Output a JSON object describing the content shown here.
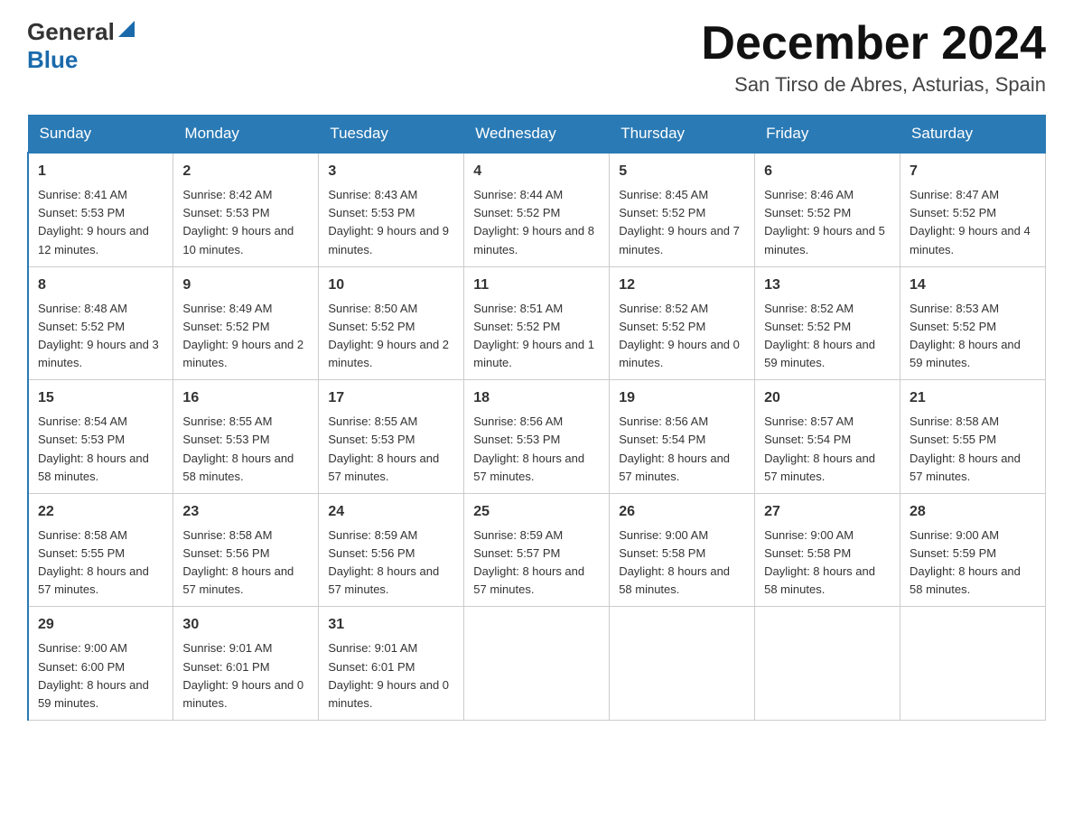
{
  "logo": {
    "general": "General",
    "blue": "Blue",
    "triangle": "▲"
  },
  "header": {
    "month_year": "December 2024",
    "location": "San Tirso de Abres, Asturias, Spain"
  },
  "weekdays": [
    "Sunday",
    "Monday",
    "Tuesday",
    "Wednesday",
    "Thursday",
    "Friday",
    "Saturday"
  ],
  "weeks": [
    [
      {
        "day": "1",
        "sunrise": "8:41 AM",
        "sunset": "5:53 PM",
        "daylight": "9 hours and 12 minutes."
      },
      {
        "day": "2",
        "sunrise": "8:42 AM",
        "sunset": "5:53 PM",
        "daylight": "9 hours and 10 minutes."
      },
      {
        "day": "3",
        "sunrise": "8:43 AM",
        "sunset": "5:53 PM",
        "daylight": "9 hours and 9 minutes."
      },
      {
        "day": "4",
        "sunrise": "8:44 AM",
        "sunset": "5:52 PM",
        "daylight": "9 hours and 8 minutes."
      },
      {
        "day": "5",
        "sunrise": "8:45 AM",
        "sunset": "5:52 PM",
        "daylight": "9 hours and 7 minutes."
      },
      {
        "day": "6",
        "sunrise": "8:46 AM",
        "sunset": "5:52 PM",
        "daylight": "9 hours and 5 minutes."
      },
      {
        "day": "7",
        "sunrise": "8:47 AM",
        "sunset": "5:52 PM",
        "daylight": "9 hours and 4 minutes."
      }
    ],
    [
      {
        "day": "8",
        "sunrise": "8:48 AM",
        "sunset": "5:52 PM",
        "daylight": "9 hours and 3 minutes."
      },
      {
        "day": "9",
        "sunrise": "8:49 AM",
        "sunset": "5:52 PM",
        "daylight": "9 hours and 2 minutes."
      },
      {
        "day": "10",
        "sunrise": "8:50 AM",
        "sunset": "5:52 PM",
        "daylight": "9 hours and 2 minutes."
      },
      {
        "day": "11",
        "sunrise": "8:51 AM",
        "sunset": "5:52 PM",
        "daylight": "9 hours and 1 minute."
      },
      {
        "day": "12",
        "sunrise": "8:52 AM",
        "sunset": "5:52 PM",
        "daylight": "9 hours and 0 minutes."
      },
      {
        "day": "13",
        "sunrise": "8:52 AM",
        "sunset": "5:52 PM",
        "daylight": "8 hours and 59 minutes."
      },
      {
        "day": "14",
        "sunrise": "8:53 AM",
        "sunset": "5:52 PM",
        "daylight": "8 hours and 59 minutes."
      }
    ],
    [
      {
        "day": "15",
        "sunrise": "8:54 AM",
        "sunset": "5:53 PM",
        "daylight": "8 hours and 58 minutes."
      },
      {
        "day": "16",
        "sunrise": "8:55 AM",
        "sunset": "5:53 PM",
        "daylight": "8 hours and 58 minutes."
      },
      {
        "day": "17",
        "sunrise": "8:55 AM",
        "sunset": "5:53 PM",
        "daylight": "8 hours and 57 minutes."
      },
      {
        "day": "18",
        "sunrise": "8:56 AM",
        "sunset": "5:53 PM",
        "daylight": "8 hours and 57 minutes."
      },
      {
        "day": "19",
        "sunrise": "8:56 AM",
        "sunset": "5:54 PM",
        "daylight": "8 hours and 57 minutes."
      },
      {
        "day": "20",
        "sunrise": "8:57 AM",
        "sunset": "5:54 PM",
        "daylight": "8 hours and 57 minutes."
      },
      {
        "day": "21",
        "sunrise": "8:58 AM",
        "sunset": "5:55 PM",
        "daylight": "8 hours and 57 minutes."
      }
    ],
    [
      {
        "day": "22",
        "sunrise": "8:58 AM",
        "sunset": "5:55 PM",
        "daylight": "8 hours and 57 minutes."
      },
      {
        "day": "23",
        "sunrise": "8:58 AM",
        "sunset": "5:56 PM",
        "daylight": "8 hours and 57 minutes."
      },
      {
        "day": "24",
        "sunrise": "8:59 AM",
        "sunset": "5:56 PM",
        "daylight": "8 hours and 57 minutes."
      },
      {
        "day": "25",
        "sunrise": "8:59 AM",
        "sunset": "5:57 PM",
        "daylight": "8 hours and 57 minutes."
      },
      {
        "day": "26",
        "sunrise": "9:00 AM",
        "sunset": "5:58 PM",
        "daylight": "8 hours and 58 minutes."
      },
      {
        "day": "27",
        "sunrise": "9:00 AM",
        "sunset": "5:58 PM",
        "daylight": "8 hours and 58 minutes."
      },
      {
        "day": "28",
        "sunrise": "9:00 AM",
        "sunset": "5:59 PM",
        "daylight": "8 hours and 58 minutes."
      }
    ],
    [
      {
        "day": "29",
        "sunrise": "9:00 AM",
        "sunset": "6:00 PM",
        "daylight": "8 hours and 59 minutes."
      },
      {
        "day": "30",
        "sunrise": "9:01 AM",
        "sunset": "6:01 PM",
        "daylight": "9 hours and 0 minutes."
      },
      {
        "day": "31",
        "sunrise": "9:01 AM",
        "sunset": "6:01 PM",
        "daylight": "9 hours and 0 minutes."
      },
      null,
      null,
      null,
      null
    ]
  ],
  "labels": {
    "sunrise": "Sunrise:",
    "sunset": "Sunset:",
    "daylight": "Daylight:"
  }
}
